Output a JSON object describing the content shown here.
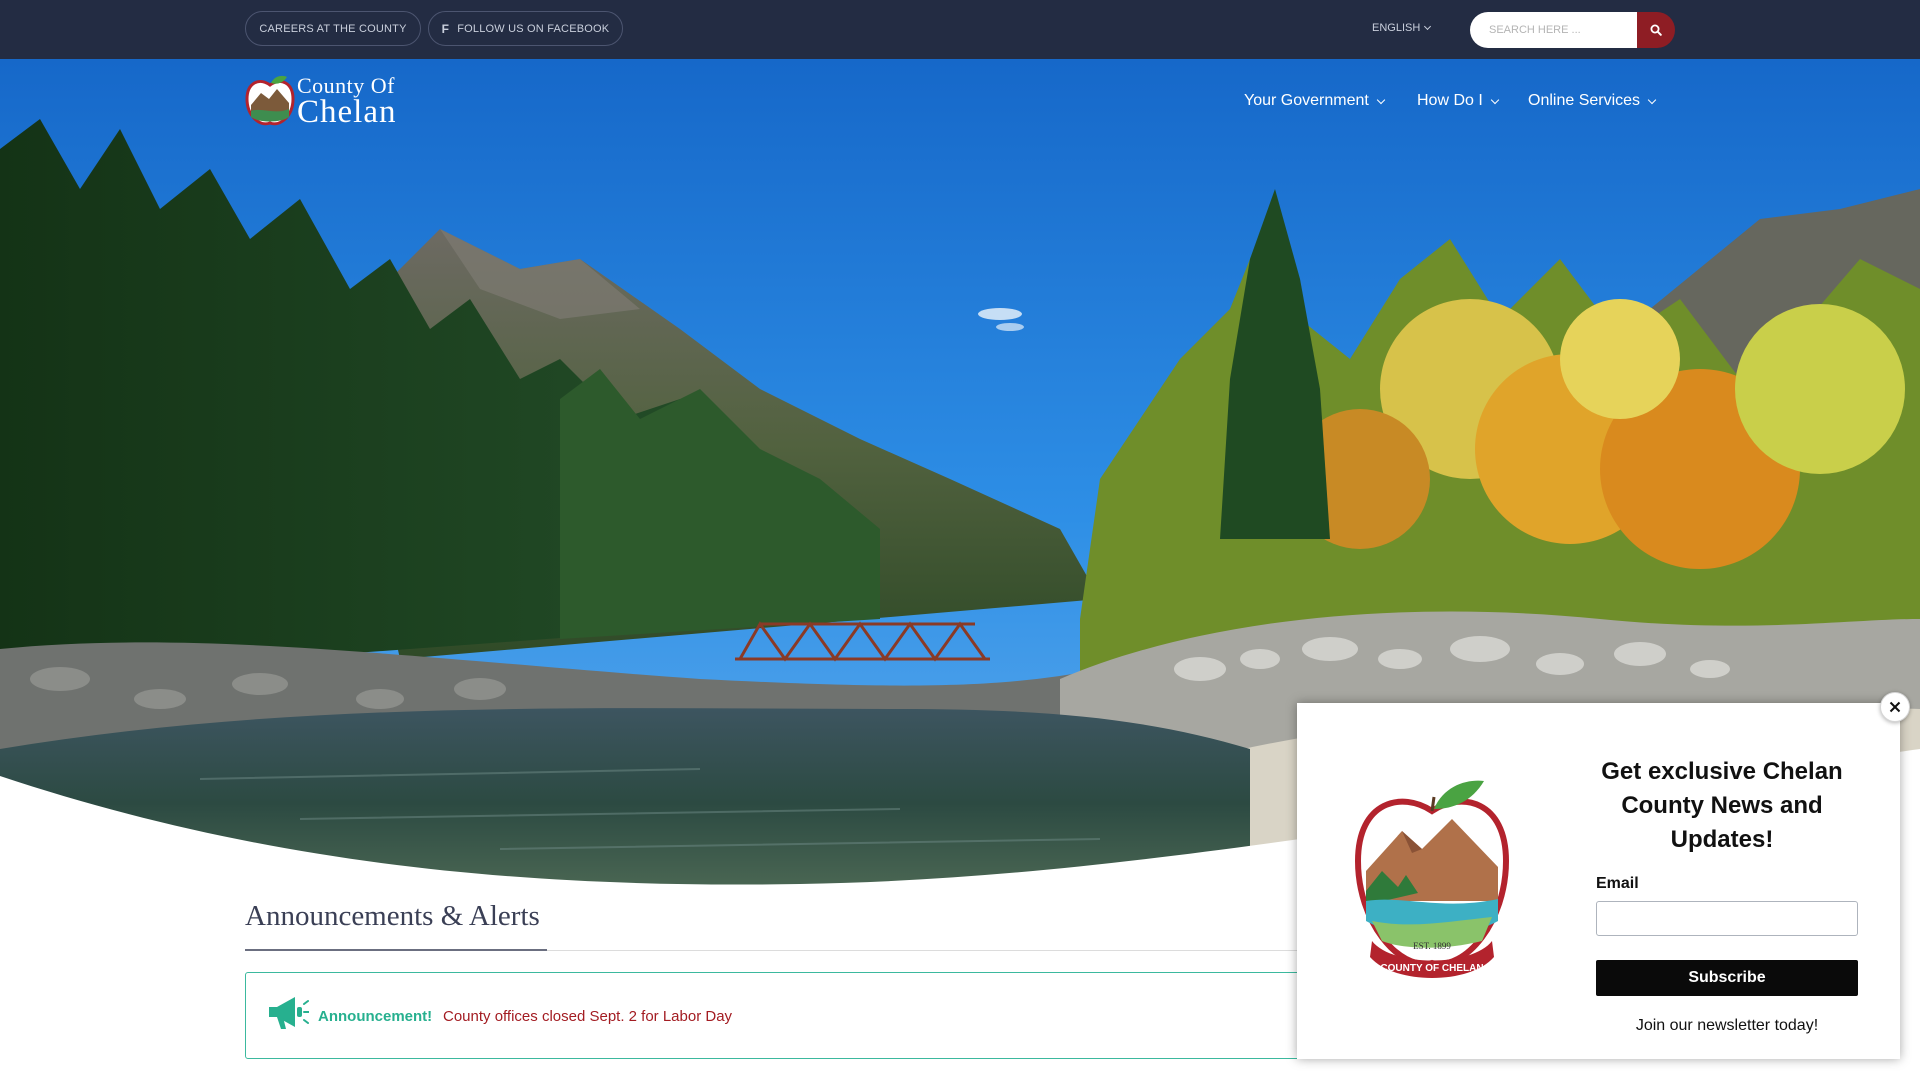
{
  "topbar": {
    "careers_label": "CAREERS AT THE COUNTY",
    "facebook_label": "FOLLOW US ON FACEBOOK",
    "language_label": "ENGLISH",
    "search_placeholder": "SEARCH HERE ...",
    "colors": {
      "background": "#232c43",
      "search_button": "#8e1d24"
    }
  },
  "header": {
    "logo_line1": "County Of",
    "logo_line2": "Chelan",
    "nav": [
      {
        "label": "Your Government",
        "icon": "chevron-down-icon"
      },
      {
        "label": "How Do I",
        "icon": "chevron-down-icon"
      },
      {
        "label": "Online Services",
        "icon": "chevron-down-icon"
      }
    ]
  },
  "hero": {
    "image": "mountain-river-bridge-autumn-trees"
  },
  "announcements": {
    "title": "Announcements & Alerts",
    "alert_label": "Announcement!",
    "alert_text": "County offices closed Sept. 2 for Labor Day",
    "colors": {
      "label": "#27b08f",
      "text": "#a31c22",
      "border": "#3bb99e"
    }
  },
  "popup": {
    "seal_text_top": "EST. 1899",
    "seal_text_bottom": "COUNTY OF CHELAN",
    "heading": "Get exclusive Chelan County News and Updates!",
    "email_label": "Email",
    "subscribe_label": "Subscribe",
    "join_text": "Join our newsletter today!",
    "close_icon": "close-icon"
  }
}
